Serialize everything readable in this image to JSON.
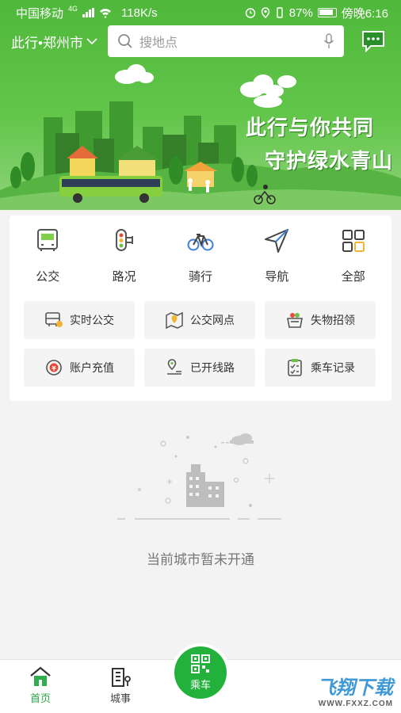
{
  "statusbar": {
    "carrier": "中国移动",
    "network": "4G",
    "speed": "118K/s",
    "battery": "87%",
    "time": "傍晚6:16"
  },
  "header": {
    "city": "此行•郑州市",
    "search_placeholder": "搜地点",
    "slogan_line1": "此行与你共同",
    "slogan_line2": "守护绿水青山",
    "colors": {
      "primary": "#22b23c",
      "banner": "#4fb83a"
    }
  },
  "quick_nav": [
    {
      "label": "公交",
      "icon": "bus-icon"
    },
    {
      "label": "路况",
      "icon": "traffic-light-icon"
    },
    {
      "label": "骑行",
      "icon": "bicycle-icon"
    },
    {
      "label": "导航",
      "icon": "navigation-icon"
    },
    {
      "label": "全部",
      "icon": "grid-icon"
    }
  ],
  "services": [
    {
      "label": "实时公交",
      "icon": "realtime-bus-icon"
    },
    {
      "label": "公交网点",
      "icon": "map-pin-icon"
    },
    {
      "label": "失物招领",
      "icon": "lost-found-icon"
    },
    {
      "label": "账户充值",
      "icon": "recharge-icon"
    },
    {
      "label": "已开线路",
      "icon": "route-icon"
    },
    {
      "label": "乘车记录",
      "icon": "ride-record-icon"
    }
  ],
  "empty_state": {
    "message": "当前城市暂未开通"
  },
  "tabbar": {
    "home": "首页",
    "city": "城事",
    "ride": "乘车"
  },
  "watermark": {
    "brand": "飞翔下载",
    "url": "WWW.FXXZ.COM"
  }
}
